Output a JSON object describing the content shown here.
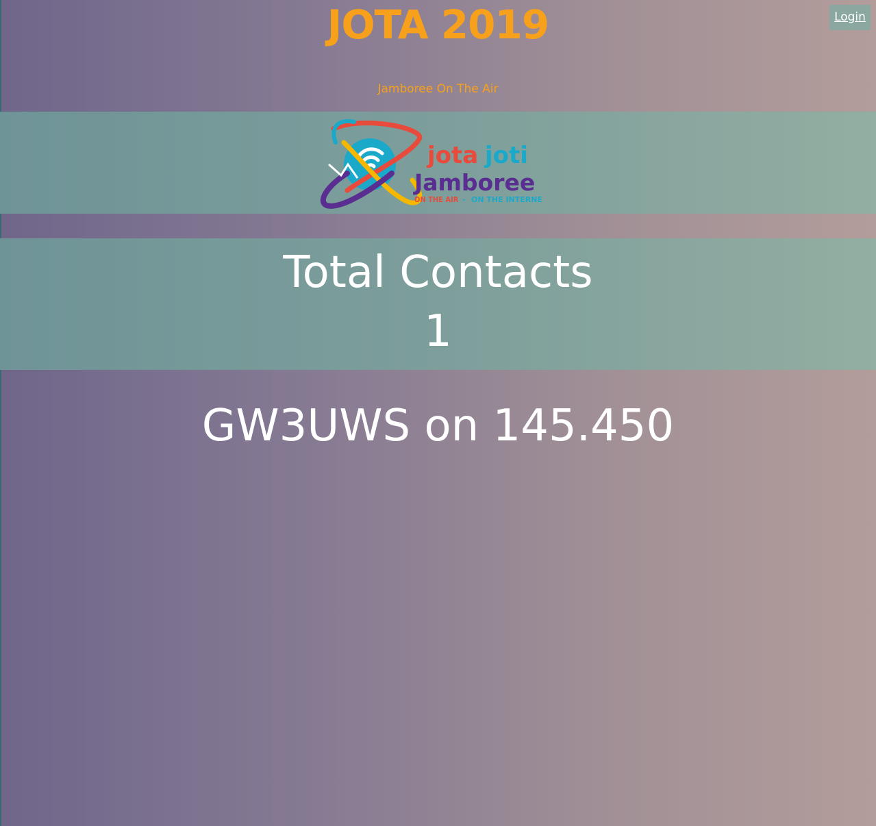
{
  "header": {
    "title": "JOTA 2019",
    "subtitle": "Jamboree On The Air",
    "login_label": "Login"
  },
  "logo": {
    "icon": "jotajoti-logo",
    "word_jota": "jota",
    "word_joti": "joti",
    "word_jamboree": "Jamboree",
    "tagline_air": "ON THE AIR",
    "tagline_sep": " - ",
    "tagline_internet": "ON THE INTERNET"
  },
  "contacts": {
    "label": "Total Contacts",
    "count": "1"
  },
  "latest": {
    "text": "GW3UWS on 145.450"
  },
  "colors": {
    "title_orange": "#f7a01c",
    "band_teal": "#7d9e9b",
    "logo_red": "#e84a3c",
    "logo_blue": "#1ba9c9",
    "logo_purple": "#5a2d91",
    "logo_yellow": "#f5b700"
  }
}
